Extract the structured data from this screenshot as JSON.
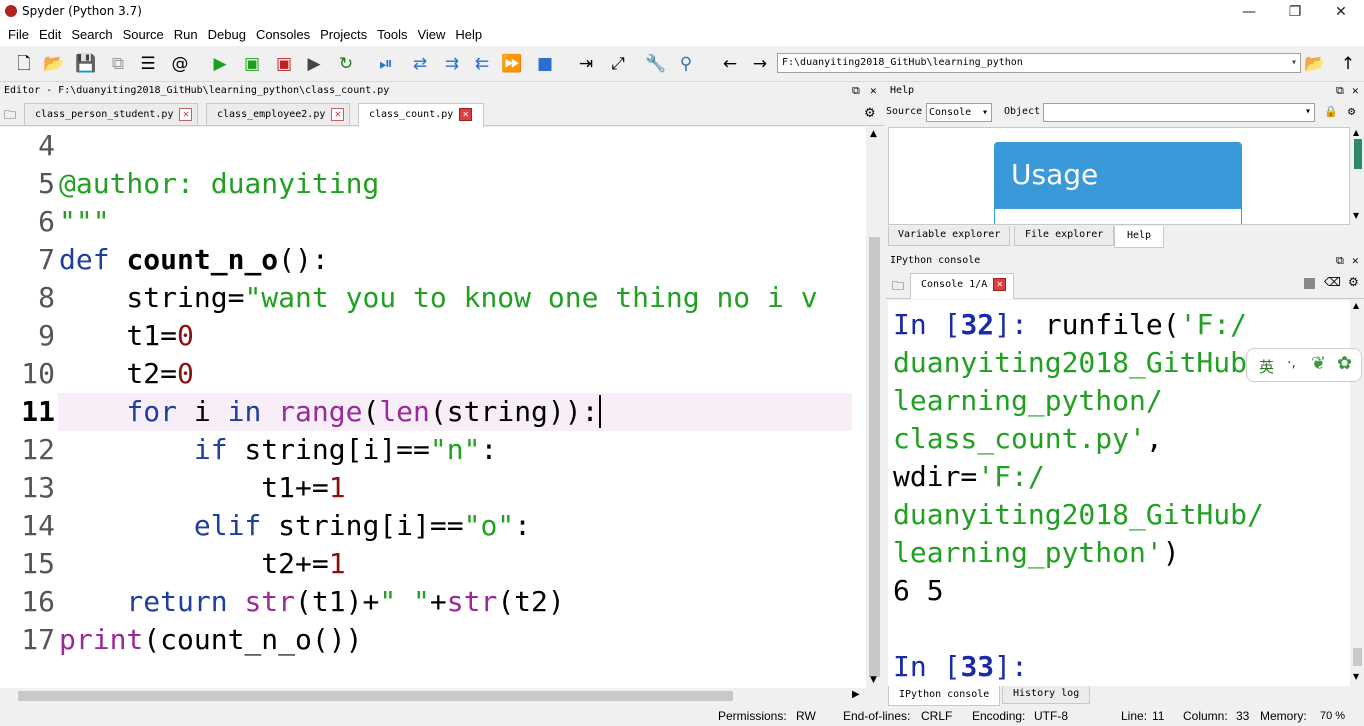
{
  "window": {
    "title": "Spyder (Python 3.7)",
    "minimize": "—",
    "maximize": "❐",
    "close": "✕"
  },
  "menu": [
    "File",
    "Edit",
    "Search",
    "Source",
    "Run",
    "Debug",
    "Consoles",
    "Projects",
    "Tools",
    "View",
    "Help"
  ],
  "toolbar": {
    "working_dir": "F:\\duanyiting2018_GitHub\\learning_python"
  },
  "editor": {
    "header": "Editor - F:\\duanyiting2018_GitHub\\learning_python\\class_count.py",
    "tabs": [
      {
        "label": "class_person_student.py",
        "close": "✕"
      },
      {
        "label": "class_employee2.py",
        "close": "✕"
      },
      {
        "label": "class_count.py",
        "close": "✕"
      }
    ],
    "line_numbers": [
      "4",
      "5",
      "6",
      "7",
      "8",
      "9",
      "10",
      "11",
      "12",
      "13",
      "14",
      "15",
      "16",
      "17"
    ],
    "lines": {
      "l5": "@author: duanyiting",
      "l6": "\"\"\"",
      "l7_kw": "def",
      "l7_fn": "count_n_o",
      "l7_rest": "():",
      "l8_a": "    string=",
      "l8_b": "\"want you to know one thing no i v",
      "l9_a": "    t1=",
      "l9_b": "0",
      "l10_a": "    t2=",
      "l10_b": "0",
      "l11_kw": "    for",
      "l11_a": " i ",
      "l11_kw2": "in",
      "l11_sp": " ",
      "l11_bi": "range",
      "l11_b": "(",
      "l11_bi2": "len",
      "l11_c": "(string)):",
      "l12_kw": "        if",
      "l12_a": " string[i]==",
      "l12_s": "\"n\"",
      "l12_b": ":",
      "l13_a": "            t1+=",
      "l13_n": "1",
      "l14_kw": "        elif",
      "l14_a": " string[i]==",
      "l14_s": "\"o\"",
      "l14_b": ":",
      "l15_a": "            t2+=",
      "l15_n": "1",
      "l16_kw": "    return",
      "l16_sp": " ",
      "l16_bi": "str",
      "l16_a": "(t1)+",
      "l16_s": "\" \"",
      "l16_b": "+",
      "l16_bi2": "str",
      "l16_c": "(t2)",
      "l17_bi": "print",
      "l17_a": "(count_n_o())"
    }
  },
  "help": {
    "header": "Help",
    "source_label": "Source",
    "source_value": "Console",
    "object_label": "Object",
    "usage_title": "Usage",
    "bottom_tabs": [
      "Variable explorer",
      "File explorer",
      "Help"
    ]
  },
  "console": {
    "header": "IPython console",
    "tab": "Console 1/A",
    "tab_close": "✕",
    "l1_in": "In [",
    "l1_num": "32",
    "l1_close": "]:",
    "l1_rest": " runfile(",
    "l1_str": "'F:/",
    "l2": "duanyiting2018_GitHub/",
    "l3": "learning_python/",
    "l4_str": "class_count.py'",
    "l4_rest": ",",
    "l5_a": "wdir=",
    "l5_str": "'F:/",
    "l6": "duanyiting2018_GitHub/",
    "l7_str": "learning_python'",
    "l7_rest": ")",
    "l8": "6 5",
    "l9_in": "In [",
    "l9_num": "33",
    "l9_close": "]:",
    "bottom_tabs": [
      "IPython console",
      "History log"
    ]
  },
  "ime": {
    "lang": "英"
  },
  "status": {
    "permissions_label": "Permissions:",
    "permissions": "RW",
    "eol_label": "End-of-lines:",
    "eol": "CRLF",
    "encoding_label": "Encoding:",
    "encoding": "UTF-8",
    "line_label": "Line:",
    "line": "11",
    "column_label": "Column:",
    "column": "33",
    "memory_label": "Memory:",
    "memory": "70 %"
  }
}
